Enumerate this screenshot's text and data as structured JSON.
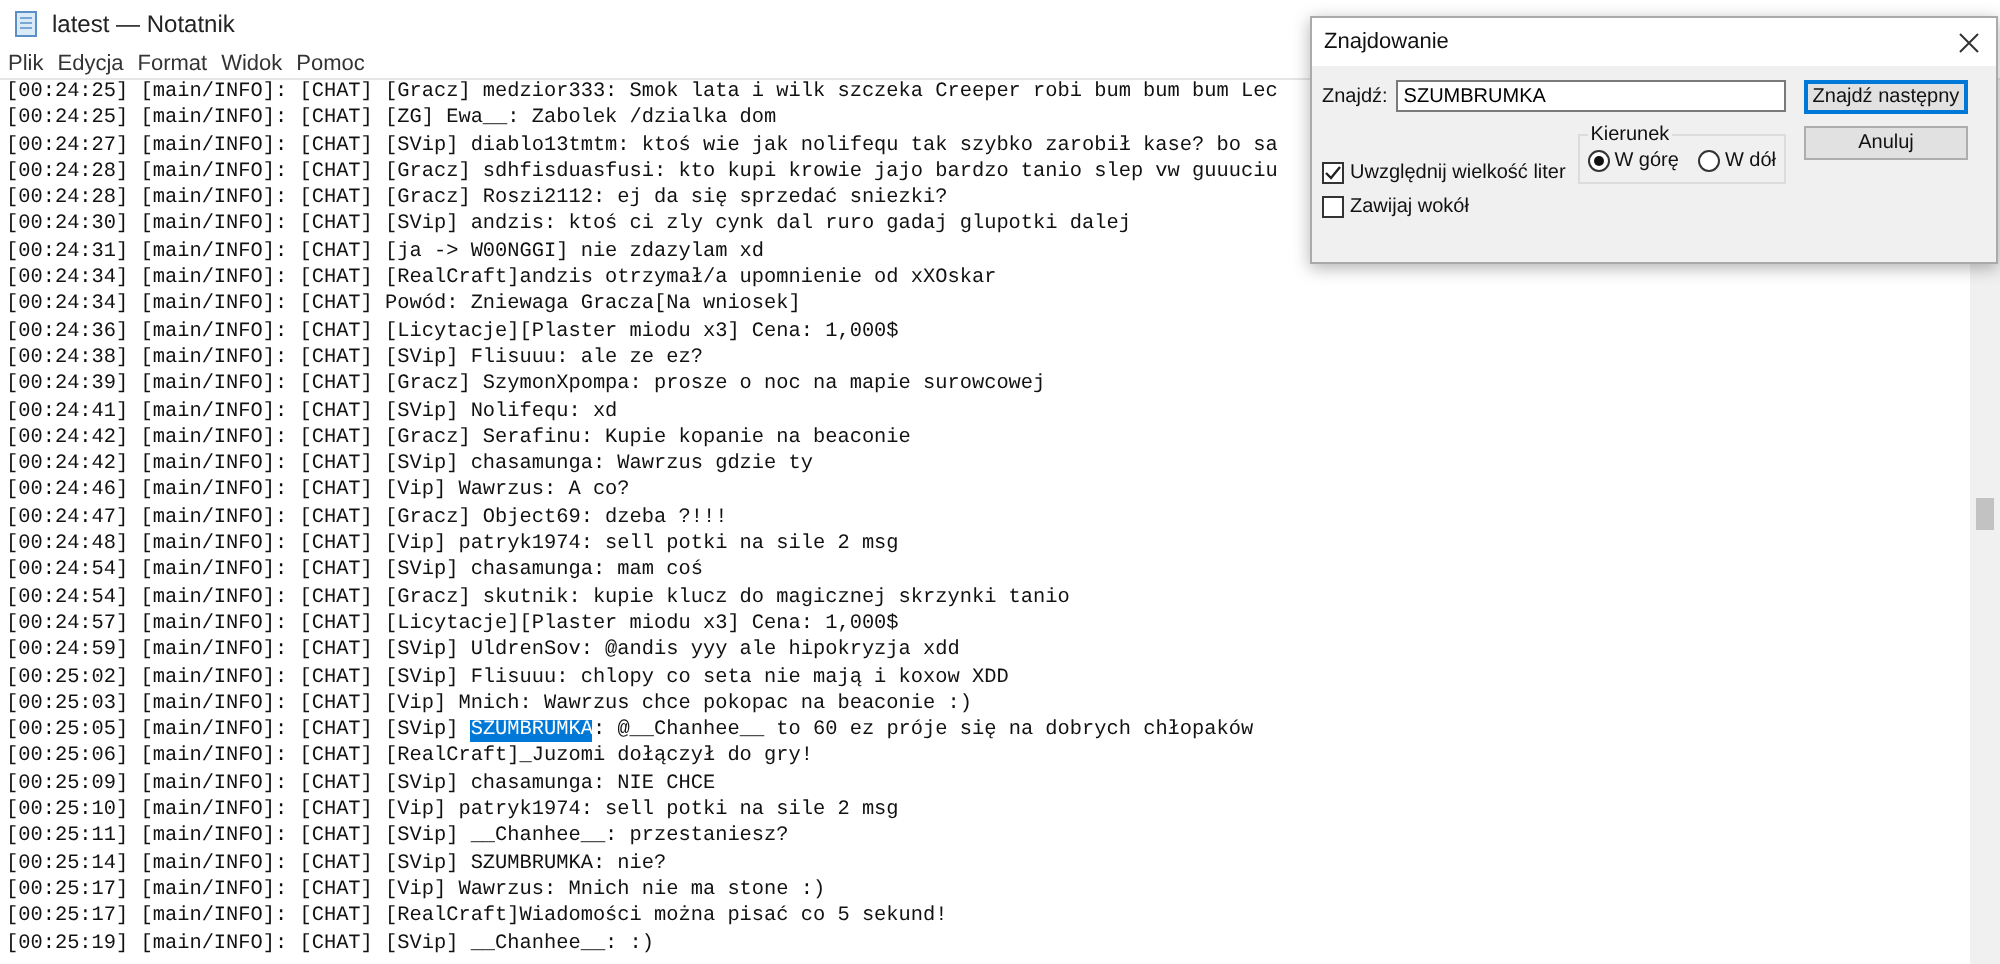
{
  "window": {
    "title": "latest — Notatnik"
  },
  "menu": [
    "Plik",
    "Edycja",
    "Format",
    "Widok",
    "Pomoc"
  ],
  "lines": [
    {
      "segments": [
        {
          "text": "[00:24:25] [main/INFO]: [CHAT] [Gracz] medzior333: Smok lata i wilk szczeka Creeper robi bum bum bum Lec",
          "selected": false
        }
      ]
    },
    {
      "segments": [
        {
          "text": "[00:24:25] [main/INFO]: [CHAT] [ZG] Ewa__: Zabolek /dzialka dom",
          "selected": false
        }
      ]
    },
    {
      "segments": [
        {
          "text": "[00:24:27] [main/INFO]: [CHAT] [SVip] diablo13tmtm: ktoś wie jak nolifequ tak szybko zarobił kase? bo sa",
          "selected": false
        }
      ]
    },
    {
      "segments": [
        {
          "text": "[00:24:28] [main/INFO]: [CHAT] [Gracz] sdhfisduasfusi: kto kupi krowie jajo bardzo tanio slep vw guuuciu",
          "selected": false
        }
      ]
    },
    {
      "segments": [
        {
          "text": "[00:24:28] [main/INFO]: [CHAT] [Gracz] Roszi2112: ej da się sprzedać sniezki?",
          "selected": false
        }
      ]
    },
    {
      "segments": [
        {
          "text": "[00:24:30] [main/INFO]: [CHAT] [SVip] andzis: ktoś ci zly cynk dal ruro gadaj glupotki dalej",
          "selected": false
        }
      ]
    },
    {
      "segments": [
        {
          "text": "[00:24:31] [main/INFO]: [CHAT] [ja -> W00NGGI] nie zdazylam xd",
          "selected": false
        }
      ]
    },
    {
      "segments": [
        {
          "text": "[00:24:34] [main/INFO]: [CHAT] [RealCraft]andzis otrzymał/a upomnienie od xXOskar",
          "selected": false
        }
      ]
    },
    {
      "segments": [
        {
          "text": "[00:24:34] [main/INFO]: [CHAT] Powód: Zniewaga Gracza[Na wniosek]",
          "selected": false
        }
      ]
    },
    {
      "segments": [
        {
          "text": "[00:24:36] [main/INFO]: [CHAT] [Licytacje][Plaster miodu x3] Cena: 1,000$",
          "selected": false
        }
      ]
    },
    {
      "segments": [
        {
          "text": "[00:24:38] [main/INFO]: [CHAT] [SVip] Flisuuu: ale ze ez?",
          "selected": false
        }
      ]
    },
    {
      "segments": [
        {
          "text": "[00:24:39] [main/INFO]: [CHAT] [Gracz] SzymonXpompa: prosze o noc na mapie surowcowej",
          "selected": false
        }
      ]
    },
    {
      "segments": [
        {
          "text": "[00:24:41] [main/INFO]: [CHAT] [SVip] Nolifequ: xd",
          "selected": false
        }
      ]
    },
    {
      "segments": [
        {
          "text": "[00:24:42] [main/INFO]: [CHAT] [Gracz] Serafinu: Kupie kopanie na beaconie",
          "selected": false
        }
      ]
    },
    {
      "segments": [
        {
          "text": "[00:24:42] [main/INFO]: [CHAT] [SVip] chasamunga: Wawrzus gdzie ty",
          "selected": false
        }
      ]
    },
    {
      "segments": [
        {
          "text": "[00:24:46] [main/INFO]: [CHAT] [Vip] Wawrzus: A co?",
          "selected": false
        }
      ]
    },
    {
      "segments": [
        {
          "text": "[00:24:47] [main/INFO]: [CHAT] [Gracz] Object69: dzeba ?!!!",
          "selected": false
        }
      ]
    },
    {
      "segments": [
        {
          "text": "[00:24:48] [main/INFO]: [CHAT] [Vip] patryk1974: sell potki na sile 2 msg",
          "selected": false
        }
      ]
    },
    {
      "segments": [
        {
          "text": "[00:24:54] [main/INFO]: [CHAT] [SVip] chasamunga: mam coś",
          "selected": false
        }
      ]
    },
    {
      "segments": [
        {
          "text": "[00:24:54] [main/INFO]: [CHAT] [Gracz] skutnik: kupie klucz do magicznej skrzynki tanio",
          "selected": false
        }
      ]
    },
    {
      "segments": [
        {
          "text": "[00:24:57] [main/INFO]: [CHAT] [Licytacje][Plaster miodu x3] Cena: 1,000$",
          "selected": false
        }
      ]
    },
    {
      "segments": [
        {
          "text": "[00:24:59] [main/INFO]: [CHAT] [SVip] UldrenSov: @andis yyy ale hipokryzja xdd",
          "selected": false
        }
      ]
    },
    {
      "segments": [
        {
          "text": "[00:25:02] [main/INFO]: [CHAT] [SVip] Flisuuu: chlopy co seta nie mają i koxow XDD",
          "selected": false
        }
      ]
    },
    {
      "segments": [
        {
          "text": "[00:25:03] [main/INFO]: [CHAT] [Vip] Mnich: Wawrzus chce pokopac na beaconie :)",
          "selected": false
        }
      ]
    },
    {
      "segments": [
        {
          "text": "[00:25:05] [main/INFO]: [CHAT] [SVip] ",
          "selected": false
        },
        {
          "text": "SZUMBRUMKA",
          "selected": true
        },
        {
          "text": ": @__Chanhee__ to 60 ez próje się na dobrych chłopaków",
          "selected": false
        }
      ]
    },
    {
      "segments": [
        {
          "text": "[00:25:06] [main/INFO]: [CHAT] [RealCraft]_Juzomi dołączył do gry!",
          "selected": false
        }
      ]
    },
    {
      "segments": [
        {
          "text": "[00:25:09] [main/INFO]: [CHAT] [SVip] chasamunga: NIE CHCE",
          "selected": false
        }
      ]
    },
    {
      "segments": [
        {
          "text": "[00:25:10] [main/INFO]: [CHAT] [Vip] patryk1974: sell potki na sile 2 msg",
          "selected": false
        }
      ]
    },
    {
      "segments": [
        {
          "text": "[00:25:11] [main/INFO]: [CHAT] [SVip] __Chanhee__: przestaniesz?",
          "selected": false
        }
      ]
    },
    {
      "segments": [
        {
          "text": "[00:25:14] [main/INFO]: [CHAT] [SVip] SZUMBRUMKA: nie?",
          "selected": false
        }
      ]
    },
    {
      "segments": [
        {
          "text": "[00:25:17] [main/INFO]: [CHAT] [Vip] Wawrzus: Mnich nie ma stone :)",
          "selected": false
        }
      ]
    },
    {
      "segments": [
        {
          "text": "[00:25:17] [main/INFO]: [CHAT] [RealCraft]Wiadomości można pisać co 5 sekund!",
          "selected": false
        }
      ]
    },
    {
      "segments": [
        {
          "text": "[00:25:19] [main/INFO]: [CHAT] [SVip] __Chanhee__: :)",
          "selected": false
        }
      ]
    }
  ],
  "find_dialog": {
    "title": "Znajdowanie",
    "find_label": "Znajdź:",
    "find_value": "SZUMBRUMKA",
    "buttons": [
      {
        "label": "Znajdź następny",
        "default": true
      },
      {
        "label": "Anuluj",
        "default": false
      }
    ],
    "direction": {
      "title": "Kierunek",
      "options": [
        {
          "label": "W górę",
          "selected": true
        },
        {
          "label": "W dół",
          "selected": false
        }
      ]
    },
    "options": [
      {
        "label": "Uwzględnij wielkość liter",
        "checked": true
      },
      {
        "label": "Zawijaj wokół",
        "checked": false
      }
    ]
  }
}
